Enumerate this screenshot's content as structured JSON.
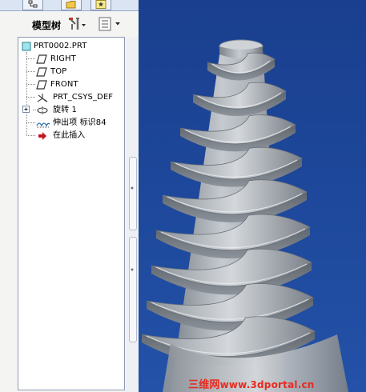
{
  "model_tree": {
    "header_label": "模型树",
    "items": [
      {
        "label": "PRT0002.PRT",
        "icon": "part-icon"
      },
      {
        "label": "RIGHT",
        "icon": "datum-plane-icon"
      },
      {
        "label": "TOP",
        "icon": "datum-plane-icon"
      },
      {
        "label": "FRONT",
        "icon": "datum-plane-icon"
      },
      {
        "label": "PRT_CSYS_DEF",
        "icon": "csys-icon"
      },
      {
        "label": "旋转 1",
        "icon": "revolve-icon"
      },
      {
        "label": "伸出项 标识84",
        "icon": "sweep-protrusion-icon"
      },
      {
        "label": "在此插入",
        "icon": "insert-here-arrow-icon"
      }
    ]
  },
  "watermark": {
    "brand": "三维网",
    "url": "www.3dportal.cn"
  },
  "colors": {
    "viewport_bg": "#1d479a",
    "model_gray": "#b4b9c0",
    "watermark": "#e82a1f"
  }
}
